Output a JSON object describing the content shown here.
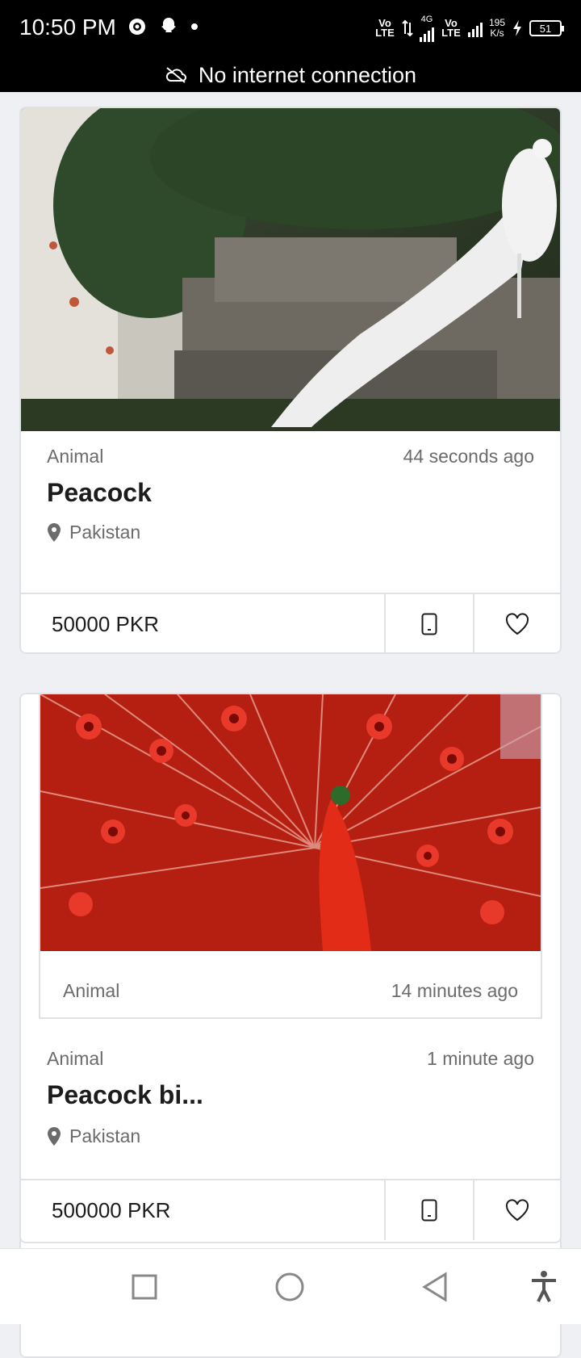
{
  "status_bar": {
    "time": "10:50 PM",
    "net_speed_value": "195",
    "net_speed_unit": "K/s",
    "battery": "51",
    "network_type": "4G",
    "volte": "Vo LTE"
  },
  "connection_banner": {
    "text": "No internet connection",
    "icon": "cloud-off-icon"
  },
  "listings": [
    {
      "category": "Animal",
      "time_ago": "44 seconds ago",
      "title": "Peacock",
      "location": "Pakistan",
      "price": "50000 PKR",
      "image": "white peacock on stone steps"
    },
    {
      "category": "Animal",
      "time_ago": "14 minutes ago",
      "image": "red peacock with fanned tail"
    },
    {
      "category": "Animal",
      "time_ago": "1 minute ago",
      "title": "Peacock bi...",
      "location": "Pakistan",
      "price": "500000 PKR"
    }
  ],
  "colors": {
    "accent_text": "#1c1c1c",
    "muted_text": "#6b6b6b",
    "background": "#eef0f3"
  },
  "nav_bar": {
    "icons": [
      "recents-square-icon",
      "home-circle-icon",
      "back-triangle-icon",
      "accessibility-icon"
    ]
  }
}
